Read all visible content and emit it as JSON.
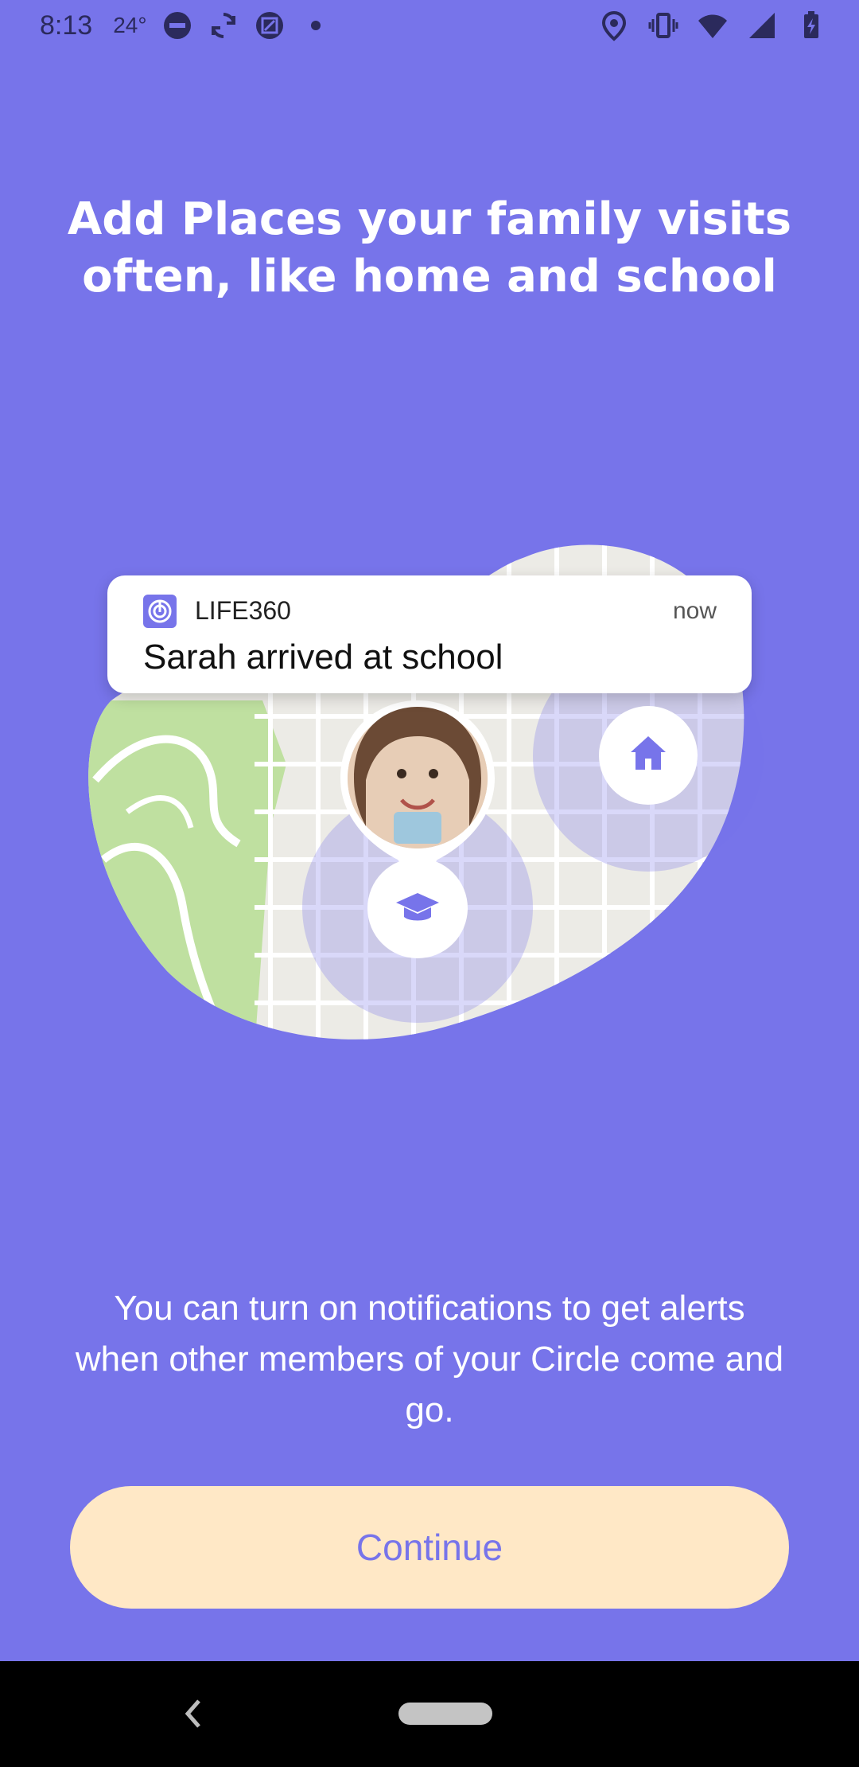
{
  "status_bar": {
    "time": "8:13",
    "temperature": "24°",
    "icons_left": [
      "do-not-disturb-icon",
      "sync-icon",
      "screenshot-icon",
      "dot-icon"
    ],
    "icons_right": [
      "location-icon",
      "vibrate-icon",
      "wifi-icon",
      "cell-signal-icon",
      "battery-charging-icon"
    ]
  },
  "onboarding": {
    "headline_line1": "Add Places your family visits",
    "headline_line2": "often, like home and school",
    "body_text": "You can turn on notifications to get alerts when other members of your Circle come and go.",
    "continue_label": "Continue"
  },
  "notification": {
    "app_name": "LIFE360",
    "time": "now",
    "message": "Sarah arrived at school"
  },
  "colors": {
    "background": "#7774EA",
    "button": "#FFE8C6",
    "accent": "#7774EA",
    "map_ground": "#ECEBE6",
    "park": "#BFE0A0"
  },
  "icons": {
    "home_place": "home-icon",
    "school_place": "graduation-cap-icon",
    "nav_back": "back-chevron-icon",
    "nav_home": "home-pill"
  }
}
